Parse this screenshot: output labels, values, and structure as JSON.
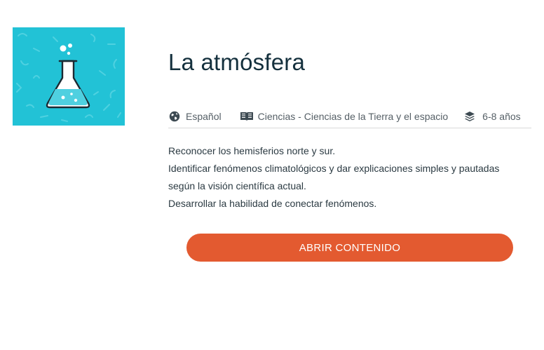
{
  "course": {
    "title": "La atmósfera",
    "thumbnail_icon": "flask-icon",
    "thumbnail_color": "#22c2d6"
  },
  "meta": {
    "language": {
      "icon": "globe-icon",
      "label": "Español"
    },
    "subject": {
      "icon": "book-icon",
      "label": "Ciencias - Ciencias de la Tierra y el espacio"
    },
    "age": {
      "icon": "layers-icon",
      "label": "6-8 años"
    }
  },
  "description": [
    "Reconocer los hemisferios norte y sur.",
    "Identificar fenómenos climatológicos y dar explicaciones simples y pautadas",
    "según la visión científica actual.",
    "Desarrollar la habilidad de conectar fenómenos."
  ],
  "actions": {
    "open_label": "ABRIR CONTENIDO",
    "open_color": "#e35a30"
  }
}
